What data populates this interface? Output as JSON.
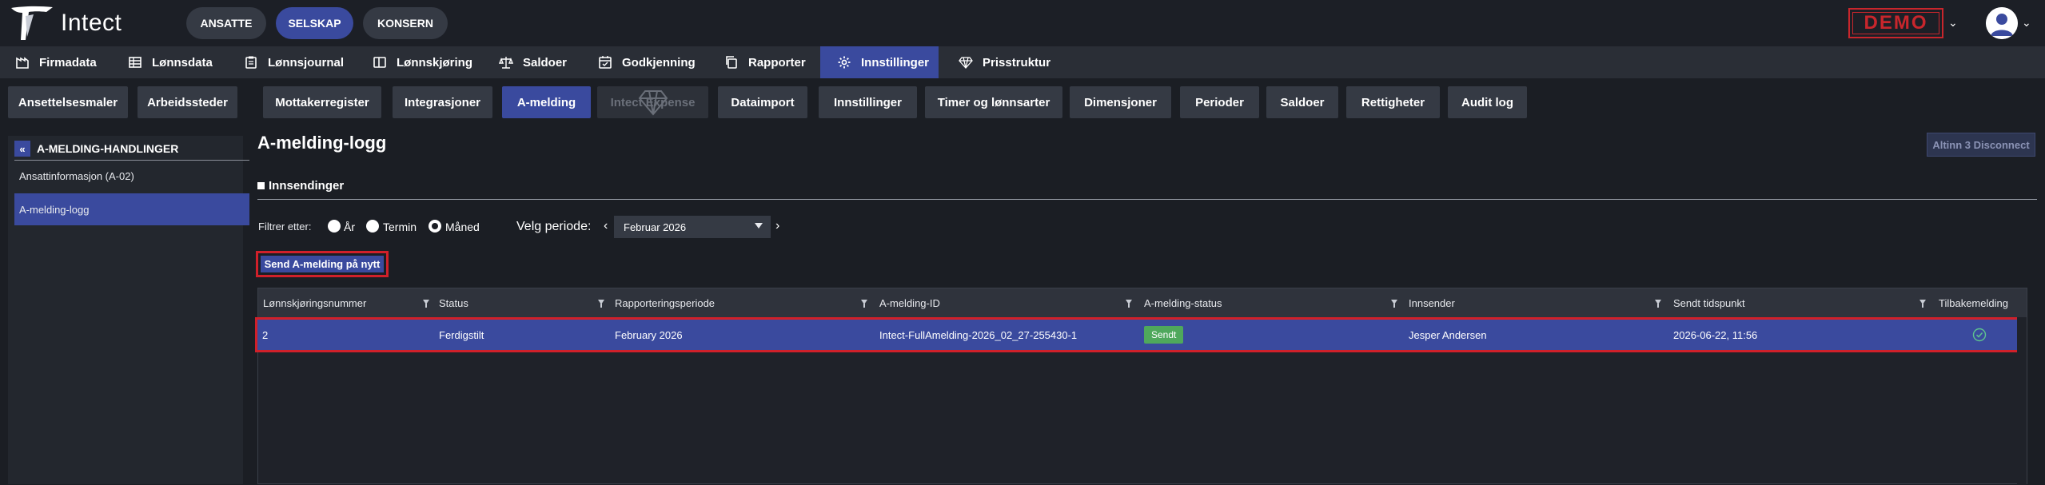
{
  "app": {
    "brand": "Intect",
    "modes": [
      "ANSATTE",
      "SELSKAP",
      "KONSERN"
    ],
    "active_mode": "SELSKAP",
    "demo_label": "DEMO"
  },
  "main_nav": [
    {
      "label": "Firmadata",
      "icon": "company-icon"
    },
    {
      "label": "Lønnsdata",
      "icon": "table-icon"
    },
    {
      "label": "Lønnsjournal",
      "icon": "clipboard-icon"
    },
    {
      "label": "Lønnskjøring",
      "icon": "columns-icon"
    },
    {
      "label": "Saldoer",
      "icon": "scale-icon"
    },
    {
      "label": "Godkjenning",
      "icon": "calendar-check-icon"
    },
    {
      "label": "Rapporter",
      "icon": "copy-icon"
    },
    {
      "label": "Innstillinger",
      "icon": "gear-icon"
    },
    {
      "label": "Prisstruktur",
      "icon": "diamond-icon"
    }
  ],
  "sub_nav": [
    "Ansettelsesmaler",
    "Arbeidssteder",
    "Mottakerregister",
    "Integrasjoner",
    "A-melding",
    "Intect Expense",
    "Dataimport",
    "Innstillinger",
    "Timer og lønnsarter",
    "Dimensjoner",
    "Perioder",
    "Saldoer",
    "Rettigheter",
    "Audit log"
  ],
  "sidebar": {
    "title": "A-MELDING-HANDLINGER",
    "items": [
      "Ansattinformasjon (A-02)",
      "A-melding-logg"
    ]
  },
  "page": {
    "title": "A-melding-logg",
    "altinn_button": "Altinn 3 Disconnect",
    "section": "Innsendinger",
    "filter_label": "Filtrer etter:",
    "filter_options": [
      "År",
      "Termin",
      "Måned"
    ],
    "filter_selected": "Måned",
    "period_label": "Velg periode:",
    "period_value": "Februar 2026",
    "resend_button": "Send A-melding på nytt"
  },
  "grid": {
    "columns": [
      "Lønnskjøringsnummer",
      "Status",
      "Rapporteringsperiode",
      "A-melding-ID",
      "A-melding-status",
      "Innsender",
      "Sendt tidspunkt",
      "Tilbakemelding"
    ],
    "rows": [
      {
        "run": "2",
        "status": "Ferdigstilt",
        "period": "February 2026",
        "id": "Intect-FullAmelding-2026_02_27-255430-1",
        "amelding_status": "Sendt",
        "sender": "Jesper Andersen",
        "sent": "2026-06-22, 11:56",
        "feedback_icon": "check-circle-icon"
      }
    ]
  },
  "colors": {
    "accent": "#3a4a9e",
    "highlight": "#d0202a",
    "success": "#4fa85c"
  }
}
